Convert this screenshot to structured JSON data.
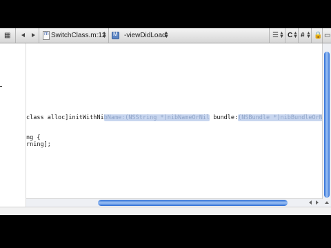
{
  "navbar": {
    "file_name": "SwitchClass.m:12",
    "method_name": "-viewDidLoad",
    "menu_c": "C",
    "menu_hash": "#"
  },
  "code": {
    "line1_prefix": "class alloc]initWithNi",
    "line1_ph1": "bName:(NSString *)nibNameOrNil",
    "line1_mid": " bundle:",
    "line1_ph2": "(NSBundle *)nibBundleOrNil",
    "line2": "ng {",
    "line3": "rning];"
  },
  "colors": {
    "selection": "#c8d6ef",
    "scroll_thumb": "#2f6fd6"
  }
}
